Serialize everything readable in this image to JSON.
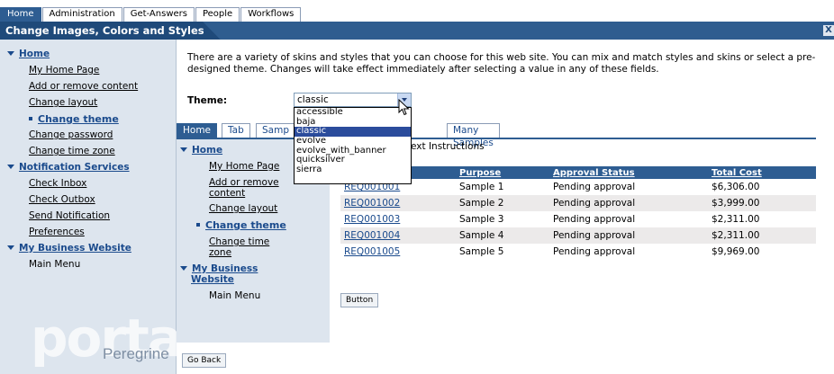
{
  "top_tabs": [
    "Home",
    "Administration",
    "Get-Answers",
    "People",
    "Workflows"
  ],
  "title": "Change Images, Colors and Styles",
  "close_glyph": "X",
  "sidebar": {
    "items": [
      {
        "label": "Home",
        "type": "group"
      },
      {
        "label": "My Home Page",
        "type": "link"
      },
      {
        "label": "Add or remove content",
        "type": "link"
      },
      {
        "label": "Change layout",
        "type": "link"
      },
      {
        "label": "Change theme",
        "type": "current"
      },
      {
        "label": "Change password",
        "type": "link"
      },
      {
        "label": "Change time zone",
        "type": "link"
      },
      {
        "label": "Notification Services",
        "type": "group"
      },
      {
        "label": "Check Inbox",
        "type": "link"
      },
      {
        "label": "Check Outbox",
        "type": "link"
      },
      {
        "label": "Send Notification",
        "type": "link"
      },
      {
        "label": "Preferences",
        "type": "link"
      },
      {
        "label": "My Business Website",
        "type": "group"
      },
      {
        "label": "Main Menu",
        "type": "link"
      }
    ],
    "logo_word": "portal",
    "logo_brand": "Peregrine"
  },
  "intro_text": "There are a variety of skins and styles that you can choose for this web site. You can mix and match styles and skins or select a pre-designed theme. Changes will take effect immediately after selecting a value in any of these fields.",
  "theme": {
    "label": "Theme:",
    "value": "classic",
    "options": [
      "accessible",
      "baja",
      "classic",
      "evolve",
      "evolve_with_banner",
      "quicksilver",
      "sierra"
    ],
    "selected_option": "classic"
  },
  "preview": {
    "tabs": [
      "Home",
      "Tab",
      "Samp",
      "Many Samples"
    ],
    "instructions": "ext Instructions",
    "sidebar": {
      "home": "Home",
      "my_home_page": "My Home Page",
      "add_remove_1": "Add or remove",
      "add_remove_2": "content",
      "change_layout": "Change layout",
      "change_theme": "Change theme",
      "change_time_1": "Change time",
      "change_time_2": "zone",
      "business_1": "My Business",
      "business_2": "Website",
      "main_menu": "Main Menu"
    },
    "table": {
      "columns": [
        "",
        "Purpose",
        "Approval Status",
        "Total Cost"
      ],
      "rows": [
        {
          "id": "REQ001001",
          "purpose": "Sample 1",
          "status": "Pending approval",
          "cost": "$6,306.00"
        },
        {
          "id": "REQ001002",
          "purpose": "Sample 2",
          "status": "Pending approval",
          "cost": "$3,999.00"
        },
        {
          "id": "REQ001003",
          "purpose": "Sample 3",
          "status": "Pending approval",
          "cost": "$2,311.00"
        },
        {
          "id": "REQ001004",
          "purpose": "Sample 4",
          "status": "Pending approval",
          "cost": "$2,311.00"
        },
        {
          "id": "REQ001005",
          "purpose": "Sample 5",
          "status": "Pending approval",
          "cost": "$9,969.00"
        }
      ]
    },
    "button_label": "Button"
  },
  "go_back_label": "Go Back",
  "colors": {
    "accent": "#2e5d92",
    "title_bar": "#1f4a7a",
    "sidebar_bg": "#dde5ee",
    "link": "#1a4a8c"
  }
}
